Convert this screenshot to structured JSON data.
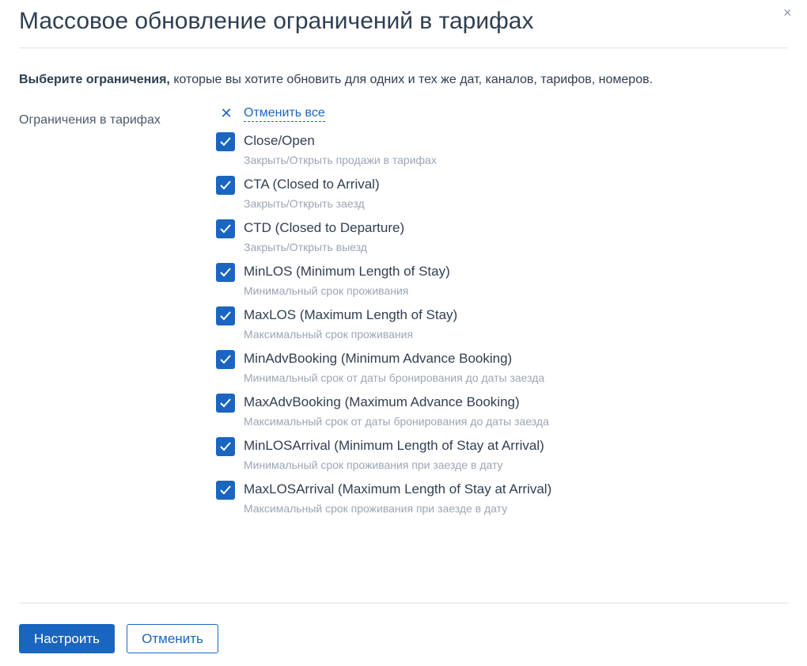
{
  "dialog": {
    "title": "Массовое обновление ограничений в тарифах",
    "close_icon": "×",
    "intro_bold": "Выберите ограничения,",
    "intro_rest": " которые вы хотите обновить для одних и тех же дат, каналов, тарифов, номеров.",
    "field_label": "Ограничения в тарифах",
    "cancel_all": "Отменить все",
    "items": [
      {
        "title": "Close/Open",
        "subtitle": "Закрыть/Открыть продажи в тарифах",
        "checked": true
      },
      {
        "title": "CTA (Closed to Arrival)",
        "subtitle": "Закрыть/Открыть заезд",
        "checked": true
      },
      {
        "title": "CTD (Closed to Departure)",
        "subtitle": "Закрыть/Открыть выезд",
        "checked": true
      },
      {
        "title": "MinLOS (Minimum Length of Stay)",
        "subtitle": "Минимальный срок проживания",
        "checked": true
      },
      {
        "title": "MaxLOS (Maximum Length of Stay)",
        "subtitle": "Максимальный срок проживания",
        "checked": true
      },
      {
        "title": "MinAdvBooking (Minimum Advance Booking)",
        "subtitle": "Минимальный срок от даты бронирования до даты заезда",
        "checked": true
      },
      {
        "title": "MaxAdvBooking (Maximum Advance Booking)",
        "subtitle": "Максимальный срок от даты бронирования до даты заезда",
        "checked": true
      },
      {
        "title": "MinLOSArrival (Minimum Length of Stay at Arrival)",
        "subtitle": "Минимальный срок проживания при заезде в дату",
        "checked": true
      },
      {
        "title": "MaxLOSArrival (Maximum Length of Stay at Arrival)",
        "subtitle": "Максимальный срок проживания при заезде в дату",
        "checked": true
      }
    ],
    "submit_label": "Настроить",
    "cancel_label": "Отменить",
    "accent_color": "#1a65c0"
  }
}
